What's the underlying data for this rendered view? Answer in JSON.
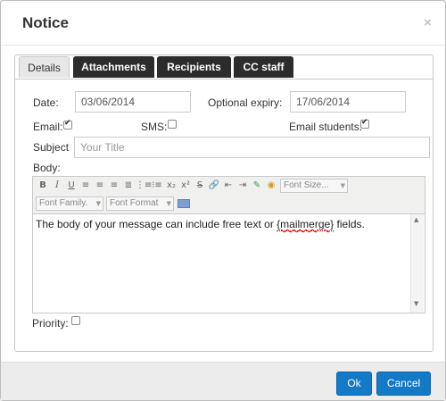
{
  "dialog": {
    "title": "Notice",
    "close_glyph": "×"
  },
  "tabs": [
    {
      "label": "Details",
      "active": true
    },
    {
      "label": "Attachments",
      "active": false
    },
    {
      "label": "Recipients",
      "active": false
    },
    {
      "label": "CC staff",
      "active": false
    }
  ],
  "details": {
    "date_label": "Date:",
    "date_value": "03/06/2014",
    "expiry_label": "Optional expiry:",
    "expiry_value": "17/06/2014",
    "email_label": "Email:",
    "email_checked": true,
    "sms_label": "SMS:",
    "sms_checked": false,
    "email_students_label": "Email students:",
    "email_students_checked": true,
    "subject_label": "Subject",
    "subject_placeholder": "Your Title",
    "body_label": "Body:",
    "priority_label": "Priority:",
    "priority_checked": false
  },
  "editor": {
    "font_size_label": "Font Size...",
    "font_family_label": "Font Family.",
    "font_format_label": "Font Format",
    "body_text_before": "The body of your message can include free text or ",
    "body_text_mailmerge": "{mailmerge}",
    "body_text_after": " fields."
  },
  "footer": {
    "ok_label": "Ok",
    "cancel_label": "Cancel"
  },
  "colors": {
    "primary_button": "#1479c6",
    "tab_dark": "#2c2c2c"
  }
}
